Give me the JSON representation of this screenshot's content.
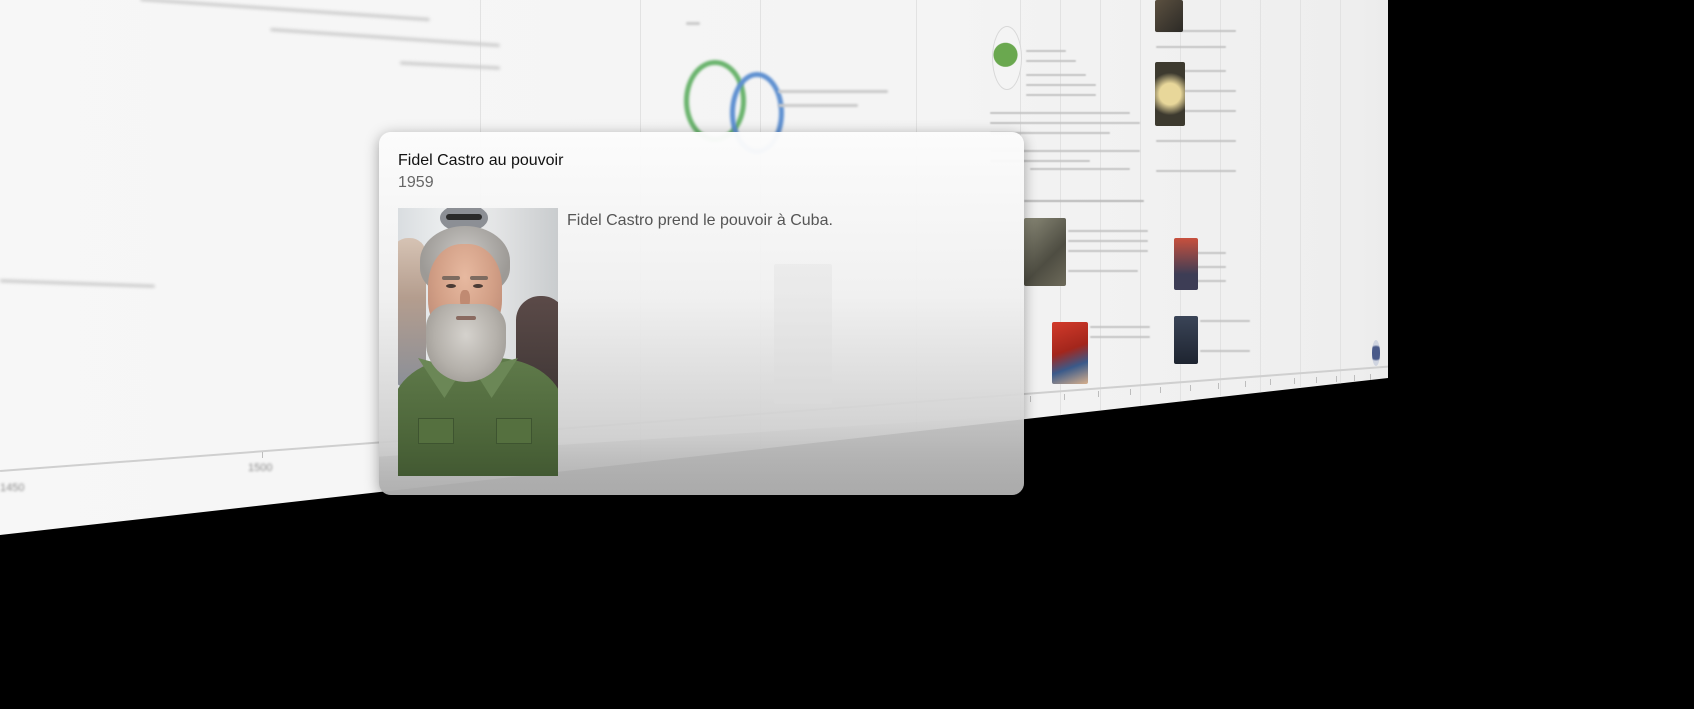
{
  "popup": {
    "title": "Fidel Castro au pouvoir",
    "date": "1959",
    "description": "Fidel Castro prend le pouvoir à Cuba.",
    "image_alt": "Fidel Castro"
  },
  "timeline_axis": {
    "labels": [
      "1450",
      "1500"
    ]
  },
  "colors": {
    "background": "#000000",
    "timeline_plane": "#f4f4f4",
    "card_title": "#111111",
    "card_text": "#555555"
  }
}
